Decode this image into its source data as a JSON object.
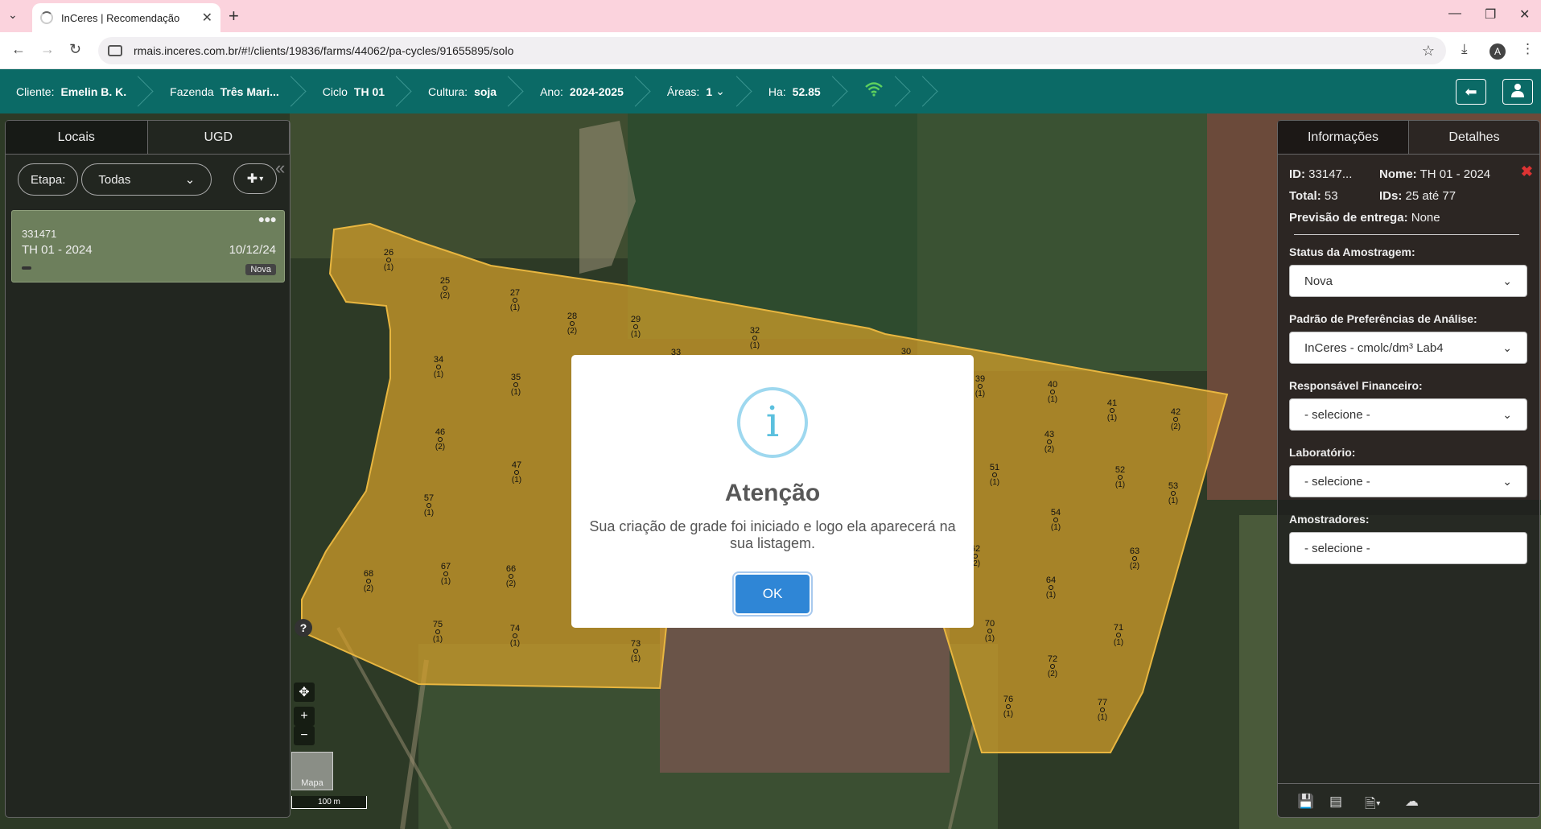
{
  "browser": {
    "tab_title": "InCeres | Recomendação",
    "url": "rmais.inceres.com.br/#!/clients/19836/farms/44062/pa-cycles/91655895/solo",
    "profile_initial": "A"
  },
  "header": {
    "cliente_label": "Cliente:",
    "cliente_value": "Emelin B. K.",
    "fazenda_label": "Fazenda",
    "fazenda_value": "Três Mari...",
    "ciclo_label": "Ciclo",
    "ciclo_value": "TH 01",
    "cultura_label": "Cultura:",
    "cultura_value": "soja",
    "ano_label": "Ano:",
    "ano_value": "2024-2025",
    "areas_label": "Áreas:",
    "areas_value": "1",
    "ha_label": "Ha:",
    "ha_value": "52.85"
  },
  "left_panel": {
    "tabs": [
      "Locais",
      "UGD"
    ],
    "etapa_label": "Etapa:",
    "etapa_value": "Todas",
    "card": {
      "id": "331471",
      "name": "TH 01 - 2024",
      "date": "10/12/24",
      "badge": "Nova"
    }
  },
  "map": {
    "thumb_label": "Mapa",
    "scale_label": "100 m",
    "points": [
      {
        "n": "26",
        "c": "(1)"
      },
      {
        "n": "25",
        "c": "(2)"
      },
      {
        "n": "27",
        "c": "(1)"
      },
      {
        "n": "28",
        "c": "(2)"
      },
      {
        "n": "29",
        "c": "(1)"
      },
      {
        "n": "32",
        "c": "(1)"
      },
      {
        "n": "33",
        "c": ""
      },
      {
        "n": "30",
        "c": ""
      },
      {
        "n": "34",
        "c": "(1)"
      },
      {
        "n": "35",
        "c": "(1)"
      },
      {
        "n": "46",
        "c": "(2)"
      },
      {
        "n": "47",
        "c": "(1)"
      },
      {
        "n": "57",
        "c": "(1)"
      },
      {
        "n": "67",
        "c": "(1)"
      },
      {
        "n": "66",
        "c": "(2)"
      },
      {
        "n": "68",
        "c": "(2)"
      },
      {
        "n": "75",
        "c": "(1)"
      },
      {
        "n": "74",
        "c": "(1)"
      },
      {
        "n": "73",
        "c": "(1)"
      },
      {
        "n": "39",
        "c": "(1)"
      },
      {
        "n": "40",
        "c": "(1)"
      },
      {
        "n": "41",
        "c": "(1)"
      },
      {
        "n": "42",
        "c": "(2)"
      },
      {
        "n": "43",
        "c": "(2)"
      },
      {
        "n": "51",
        "c": "(1)"
      },
      {
        "n": "52",
        "c": "(1)"
      },
      {
        "n": "53",
        "c": "(1)"
      },
      {
        "n": "54",
        "c": "(1)"
      },
      {
        "n": "62",
        "c": "(2)"
      },
      {
        "n": "63",
        "c": "(2)"
      },
      {
        "n": "64",
        "c": "(1)"
      },
      {
        "n": "70",
        "c": "(1)"
      },
      {
        "n": "71",
        "c": "(1)"
      },
      {
        "n": "72",
        "c": "(2)"
      },
      {
        "n": "76",
        "c": "(1)"
      },
      {
        "n": "77",
        "c": "(1)"
      }
    ]
  },
  "right_panel": {
    "tabs": [
      "Informações",
      "Detalhes"
    ],
    "id_label": "ID:",
    "id_value": "33147...",
    "nome_label": "Nome:",
    "nome_value": "TH 01 - 2024",
    "total_label": "Total:",
    "total_value": "53",
    "ids_label": "IDs:",
    "ids_value": "25 até 77",
    "previsao_label": "Previsão de entrega:",
    "previsao_value": "None",
    "status_label": "Status da Amostragem:",
    "status_value": "Nova",
    "padrao_label": "Padrão de Preferências de Análise:",
    "padrao_value": "InCeres - cmolc/dm³ Lab4",
    "resp_label": "Responsável Financeiro:",
    "resp_value": "- selecione -",
    "lab_label": "Laboratório:",
    "lab_value": "- selecione -",
    "amost_label": "Amostradores:",
    "amost_value": "- selecione -"
  },
  "modal": {
    "icon": "i",
    "title": "Atenção",
    "message": "Sua criação de grade foi iniciado e logo ela aparecerá na sua listagem.",
    "ok_label": "OK"
  },
  "colors": {
    "header_bg": "#0b6a66",
    "field_fill": "#d6a02a",
    "ok_button": "#2f86d6",
    "info_icon": "#5bc0de"
  }
}
